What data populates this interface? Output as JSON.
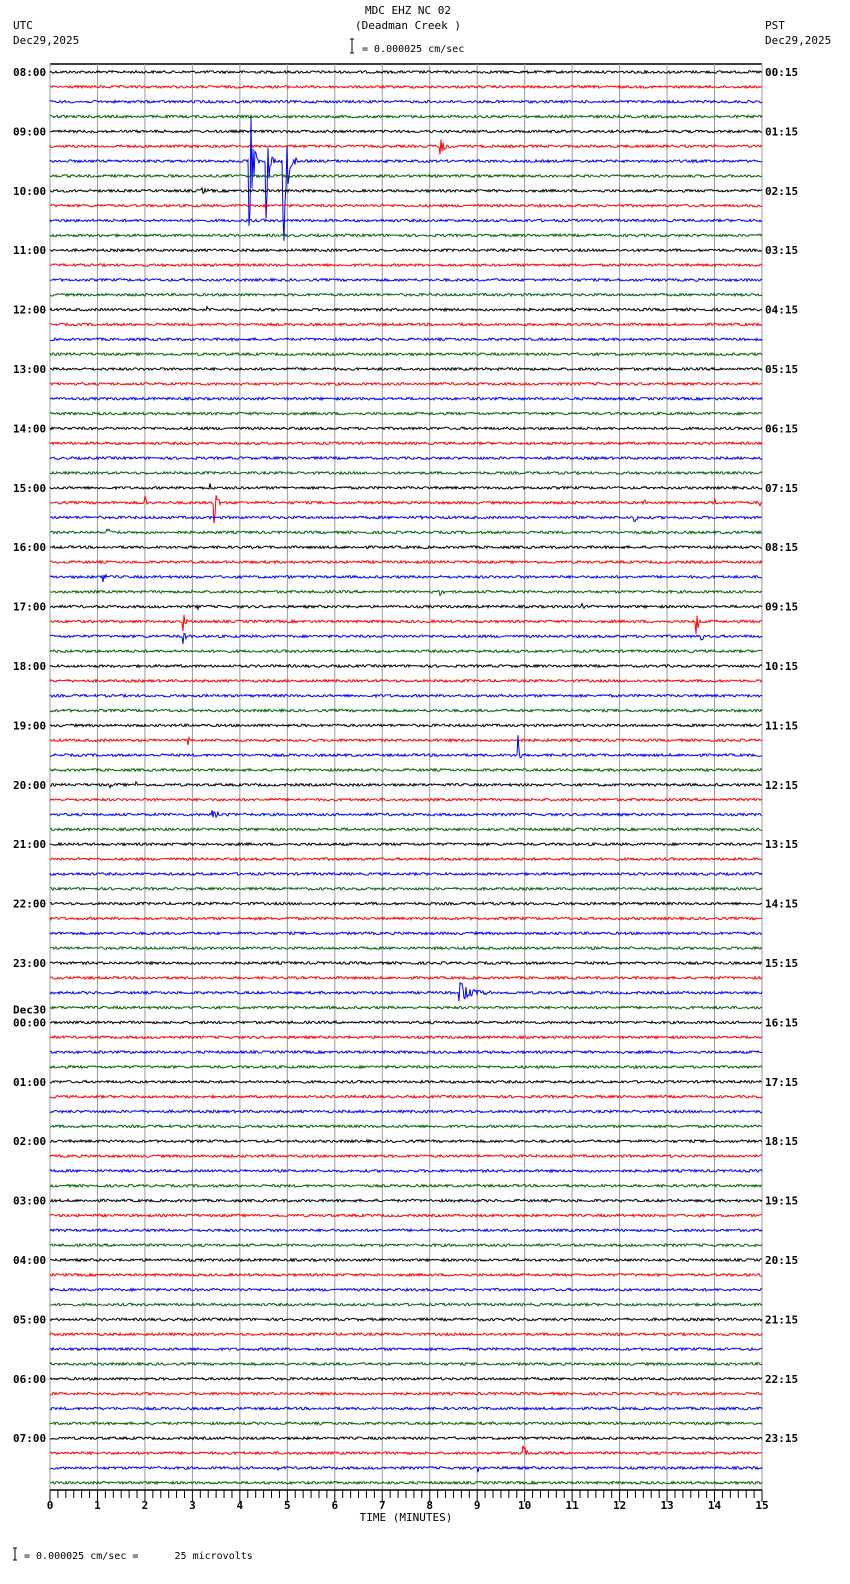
{
  "header": {
    "title": "MDC EHZ NC 02",
    "subtitle": "(Deadman Creek )",
    "left_tz": "UTC",
    "left_date": "Dec29,2025",
    "right_tz": "PST",
    "right_date": "Dec29,2025",
    "scale_text": "= 0.000025 cm/sec"
  },
  "footer": {
    "scale_text": "= 0.000025 cm/sec =      25 microvolts"
  },
  "chart_data": {
    "type": "line",
    "title": "MDC EHZ NC 02 (Deadman Creek )",
    "xlabel": "TIME (MINUTES)",
    "xlim": [
      0,
      15
    ],
    "x_ticks": [
      "0",
      "1",
      "2",
      "3",
      "4",
      "5",
      "6",
      "7",
      "8",
      "9",
      "10",
      "11",
      "12",
      "13",
      "14",
      "15"
    ],
    "grid": true,
    "trace_colors": [
      "#000000",
      "#ff0000",
      "#0000ff",
      "#006400"
    ],
    "traces_per_hour": 4,
    "left_labels": [
      "08:00",
      "09:00",
      "10:00",
      "11:00",
      "12:00",
      "13:00",
      "14:00",
      "15:00",
      "16:00",
      "17:00",
      "18:00",
      "19:00",
      "20:00",
      "21:00",
      "22:00",
      "23:00",
      "00:00",
      "01:00",
      "02:00",
      "03:00",
      "04:00",
      "05:00",
      "06:00",
      "07:00"
    ],
    "day_change_label": "Dec30",
    "day_change_index": 16,
    "right_labels": [
      "00:15",
      "01:15",
      "02:15",
      "03:15",
      "04:15",
      "05:15",
      "06:15",
      "07:15",
      "08:15",
      "09:15",
      "10:15",
      "11:15",
      "12:15",
      "13:15",
      "14:15",
      "15:15",
      "16:15",
      "17:15",
      "18:15",
      "19:15",
      "20:15",
      "21:15",
      "22:15",
      "23:15"
    ],
    "events": [
      {
        "trace": 5,
        "minute": 8.2,
        "amp": 9,
        "dur": 0.5
      },
      {
        "trace": 6,
        "minute": 4.18,
        "amp": 120,
        "dur": 0.25
      },
      {
        "trace": 6,
        "minute": 4.9,
        "amp": 125,
        "dur": 0.3
      },
      {
        "trace": 6,
        "minute": 4.55,
        "amp": 60,
        "dur": 0.2
      },
      {
        "trace": 8,
        "minute": 3.2,
        "amp": 4,
        "dur": 0.3
      },
      {
        "trace": 15,
        "minute": 1.9,
        "amp": 5,
        "dur": 0.05
      },
      {
        "trace": 16,
        "minute": 3.3,
        "amp": 4,
        "dur": 0.05
      },
      {
        "trace": 28,
        "minute": 3.35,
        "amp": 10,
        "dur": 0.1
      },
      {
        "trace": 28,
        "minute": 3.9,
        "amp": 5,
        "dur": 0.05
      },
      {
        "trace": 29,
        "minute": 3.45,
        "amp": 28,
        "dur": 0.2
      },
      {
        "trace": 29,
        "minute": 2.0,
        "amp": 10,
        "dur": 0.15
      },
      {
        "trace": 29,
        "minute": 12.5,
        "amp": 6,
        "dur": 0.1
      },
      {
        "trace": 29,
        "minute": 14.0,
        "amp": 8,
        "dur": 0.05
      },
      {
        "trace": 29,
        "minute": 14.95,
        "amp": 6,
        "dur": 0.05
      },
      {
        "trace": 30,
        "minute": 7.8,
        "amp": 6,
        "dur": 0.15
      },
      {
        "trace": 30,
        "minute": 12.3,
        "amp": 8,
        "dur": 0.15
      },
      {
        "trace": 31,
        "minute": 1.2,
        "amp": 8,
        "dur": 0.15
      },
      {
        "trace": 34,
        "minute": 1.1,
        "amp": 9,
        "dur": 0.2
      },
      {
        "trace": 35,
        "minute": 8.2,
        "amp": 8,
        "dur": 0.15
      },
      {
        "trace": 36,
        "minute": 3.1,
        "amp": 6,
        "dur": 0.1
      },
      {
        "trace": 36,
        "minute": 11.2,
        "amp": 6,
        "dur": 0.1
      },
      {
        "trace": 37,
        "minute": 2.8,
        "amp": 12,
        "dur": 0.15
      },
      {
        "trace": 37,
        "minute": 13.6,
        "amp": 26,
        "dur": 0.15
      },
      {
        "trace": 38,
        "minute": 2.8,
        "amp": 10,
        "dur": 0.15
      },
      {
        "trace": 38,
        "minute": 13.7,
        "amp": 10,
        "dur": 0.2
      },
      {
        "trace": 42,
        "minute": 8.6,
        "amp": 6,
        "dur": 0.05
      },
      {
        "trace": 42,
        "minute": 11.4,
        "amp": 4,
        "dur": 0.1
      },
      {
        "trace": 45,
        "minute": 2.9,
        "amp": 5,
        "dur": 0.1
      },
      {
        "trace": 44,
        "minute": 13.95,
        "amp": 5,
        "dur": 0.05
      },
      {
        "trace": 46,
        "minute": 9.85,
        "amp": 32,
        "dur": 0.1
      },
      {
        "trace": 48,
        "minute": 1.25,
        "amp": 8,
        "dur": 0.08
      },
      {
        "trace": 48,
        "minute": 1.8,
        "amp": 6,
        "dur": 0.05
      },
      {
        "trace": 50,
        "minute": 3.4,
        "amp": 5,
        "dur": 0.5
      },
      {
        "trace": 62,
        "minute": 8.6,
        "amp": 14,
        "dur": 0.9
      },
      {
        "trace": 93,
        "minute": 9.95,
        "amp": 10,
        "dur": 0.3
      },
      {
        "trace": 94,
        "minute": 9.0,
        "amp": 6,
        "dur": 0.1
      },
      {
        "trace": 94,
        "minute": 4.8,
        "amp": 5,
        "dur": 0.05
      }
    ]
  }
}
